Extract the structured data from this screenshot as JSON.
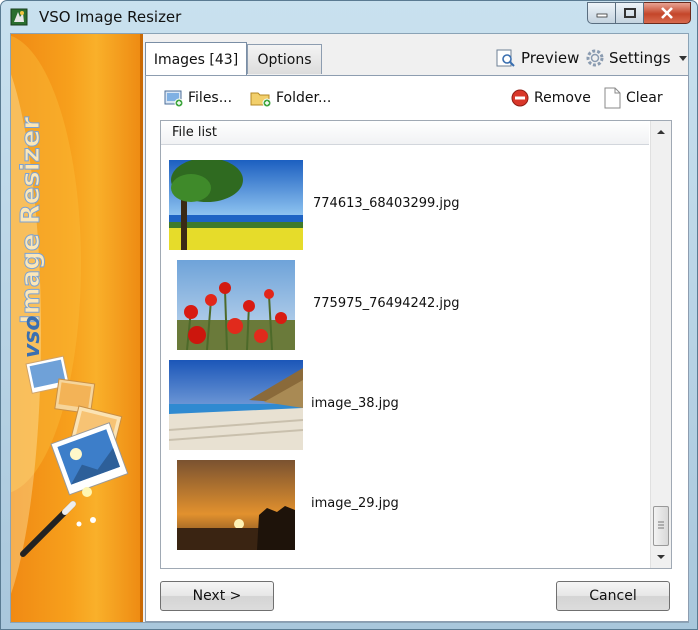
{
  "window": {
    "title": "VSO Image Resizer"
  },
  "banner": {
    "brand_text": "Image Resizer",
    "logo_text": "vso"
  },
  "tabs": [
    {
      "label": "Images [43]",
      "selected": true
    },
    {
      "label": "Options",
      "selected": false
    }
  ],
  "toolbar": {
    "preview_label": "Preview",
    "settings_label": "Settings"
  },
  "actions": {
    "files_label": "Files...",
    "folder_label": "Folder...",
    "remove_label": "Remove",
    "clear_label": "Clear"
  },
  "file_list": {
    "header": "File list",
    "items": [
      {
        "name": "774613_68403299.jpg",
        "thumbnail": "tree-field-landscape"
      },
      {
        "name": "775975_76494242.jpg",
        "thumbnail": "red-poppies"
      },
      {
        "name": "image_38.jpg",
        "thumbnail": "beach-umbrellas"
      },
      {
        "name": "image_29.jpg",
        "thumbnail": "sunset-palms"
      }
    ]
  },
  "buttons": {
    "next_label": "Next >",
    "cancel_label": "Cancel"
  },
  "colors": {
    "banner_orange": "#f39a1a",
    "accent_blue": "#3a6fb0",
    "remove_red": "#d9372a"
  }
}
